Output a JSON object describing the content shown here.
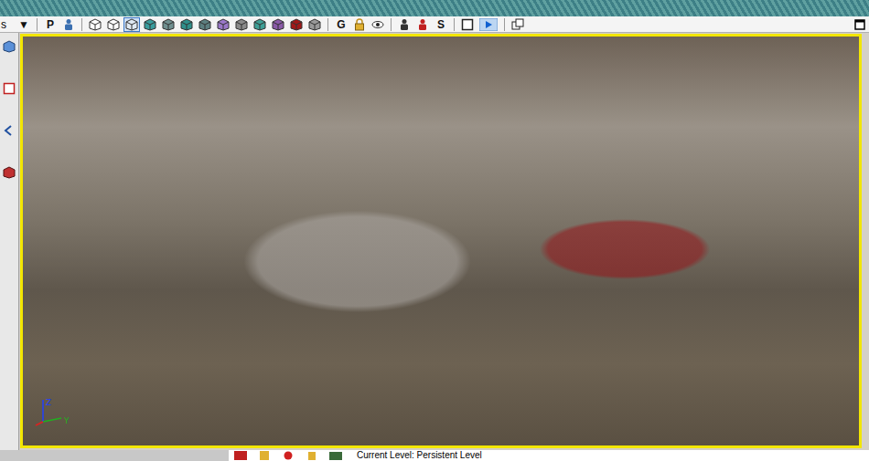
{
  "toolbar": {
    "lead_text": "s",
    "items": [
      {
        "kind": "dropdown",
        "label": "▼",
        "selected": false
      },
      {
        "kind": "separator"
      },
      {
        "kind": "text",
        "label": "P",
        "selected": false
      },
      {
        "kind": "figure",
        "color": "#3a6fb0",
        "selected": false
      },
      {
        "kind": "separator"
      },
      {
        "kind": "cube",
        "color": "#ffffff",
        "selected": false
      },
      {
        "kind": "cube",
        "color": "#ffffff",
        "selected": false
      },
      {
        "kind": "cube",
        "color": "#dfe9f3",
        "selected": true
      },
      {
        "kind": "cube",
        "color": "#3a9c9c",
        "selected": false
      },
      {
        "kind": "cube",
        "color": "#6f8f8f",
        "selected": false
      },
      {
        "kind": "cube",
        "color": "#2f8f8a",
        "selected": false
      },
      {
        "kind": "cube",
        "color": "#5c7f80",
        "selected": false
      },
      {
        "kind": "cube",
        "color": "#9a78c8",
        "selected": false
      },
      {
        "kind": "cube",
        "color": "#8a8a8a",
        "selected": false
      },
      {
        "kind": "cube",
        "color": "#3f9f96",
        "selected": false
      },
      {
        "kind": "cube",
        "color": "#8a5aa8",
        "selected": false
      },
      {
        "kind": "cube",
        "color": "#a01818",
        "selected": false
      },
      {
        "kind": "cube",
        "color": "#9a9a9a",
        "selected": false
      },
      {
        "kind": "separator"
      },
      {
        "kind": "text",
        "label": "G",
        "selected": false
      },
      {
        "kind": "lock",
        "selected": false
      },
      {
        "kind": "eye",
        "selected": false
      },
      {
        "kind": "separator"
      },
      {
        "kind": "figure",
        "color": "#333333",
        "selected": false
      },
      {
        "kind": "figure",
        "color": "#c02020",
        "selected": false
      },
      {
        "kind": "text",
        "label": "S",
        "selected": false
      },
      {
        "kind": "separator"
      },
      {
        "kind": "frame",
        "selected": false
      },
      {
        "kind": "play",
        "selected": false
      },
      {
        "kind": "separator"
      },
      {
        "kind": "camera",
        "selected": false
      }
    ]
  },
  "viewport": {
    "active": true,
    "axes": [
      {
        "label": "Z",
        "color": "#2040ff"
      },
      {
        "label": "Y",
        "color": "#20b020"
      },
      {
        "label": "",
        "color": "#e02020"
      }
    ]
  },
  "status_bar": {
    "text": "Current Level: Persistent Level"
  }
}
